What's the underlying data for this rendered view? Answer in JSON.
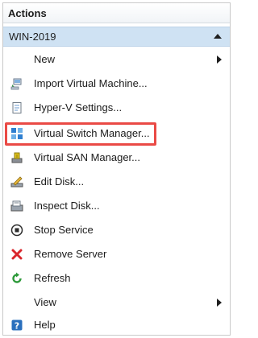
{
  "panel": {
    "title": "Actions"
  },
  "group": {
    "label": "WIN-2019"
  },
  "items": [
    {
      "label": "New",
      "icon": "none",
      "submenu": true
    },
    {
      "label": "Import Virtual Machine...",
      "icon": "import-vm-icon"
    },
    {
      "label": "Hyper-V Settings...",
      "icon": "settings-page-icon"
    },
    {
      "label": "Virtual Switch Manager...",
      "icon": "virtual-switch-icon",
      "highlighted": true
    },
    {
      "label": "Virtual SAN Manager...",
      "icon": "san-manager-icon"
    },
    {
      "label": "Edit Disk...",
      "icon": "edit-disk-icon"
    },
    {
      "label": "Inspect Disk...",
      "icon": "inspect-disk-icon"
    },
    {
      "label": "Stop Service",
      "icon": "stop-icon"
    },
    {
      "label": "Remove Server",
      "icon": "red-x-icon"
    },
    {
      "label": "Refresh",
      "icon": "refresh-icon"
    },
    {
      "label": "View",
      "icon": "none",
      "submenu": true
    },
    {
      "label": "Help",
      "icon": "help-icon"
    }
  ],
  "colors": {
    "group_bg": "#cfe2f3",
    "highlight_border": "#ea4a45",
    "remove_x": "#d9262c",
    "refresh_green": "#2e9a3b",
    "help_blue": "#2a6fbd"
  }
}
